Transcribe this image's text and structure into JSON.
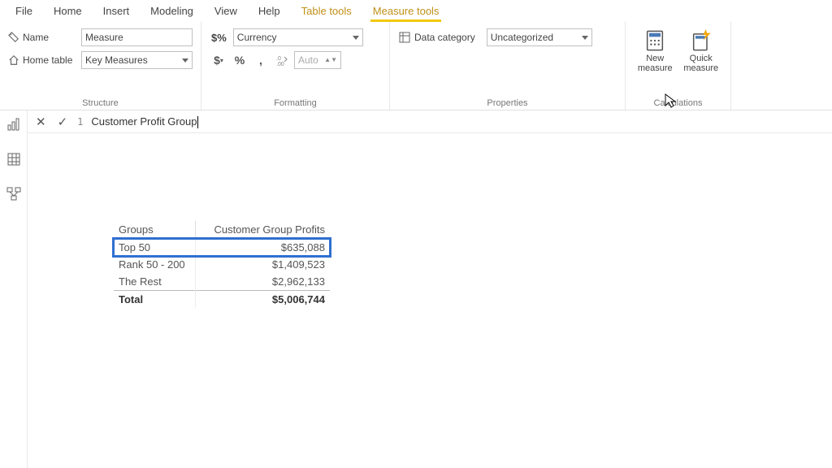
{
  "menu": {
    "file": "File",
    "home": "Home",
    "insert": "Insert",
    "modeling": "Modeling",
    "view": "View",
    "help": "Help",
    "tabletools": "Table tools",
    "measuretools": "Measure tools"
  },
  "structure": {
    "name_lbl": "Name",
    "name_val": "Measure",
    "home_lbl": "Home table",
    "home_val": "Key Measures",
    "group": "Structure"
  },
  "formatting": {
    "format_select": "Currency",
    "spinner": "Auto",
    "group": "Formatting"
  },
  "properties": {
    "datacat_lbl": "Data category",
    "datacat_val": "Uncategorized",
    "group": "Properties"
  },
  "calculations": {
    "new_l1": "New",
    "new_l2": "measure",
    "quick_l1": "Quick",
    "quick_l2": "measure",
    "group": "Calculations"
  },
  "formula": {
    "line": "1",
    "expr": "Customer Profit Group"
  },
  "visual": {
    "col1": "Groups",
    "col2": "Customer Group Profits",
    "rows": [
      {
        "g": "Top 50",
        "v": "$635,088"
      },
      {
        "g": "Rank 50 - 200",
        "v": "$1,409,523"
      },
      {
        "g": "The Rest",
        "v": "$2,962,133"
      }
    ],
    "total_lbl": "Total",
    "total_val": "$5,006,744"
  }
}
